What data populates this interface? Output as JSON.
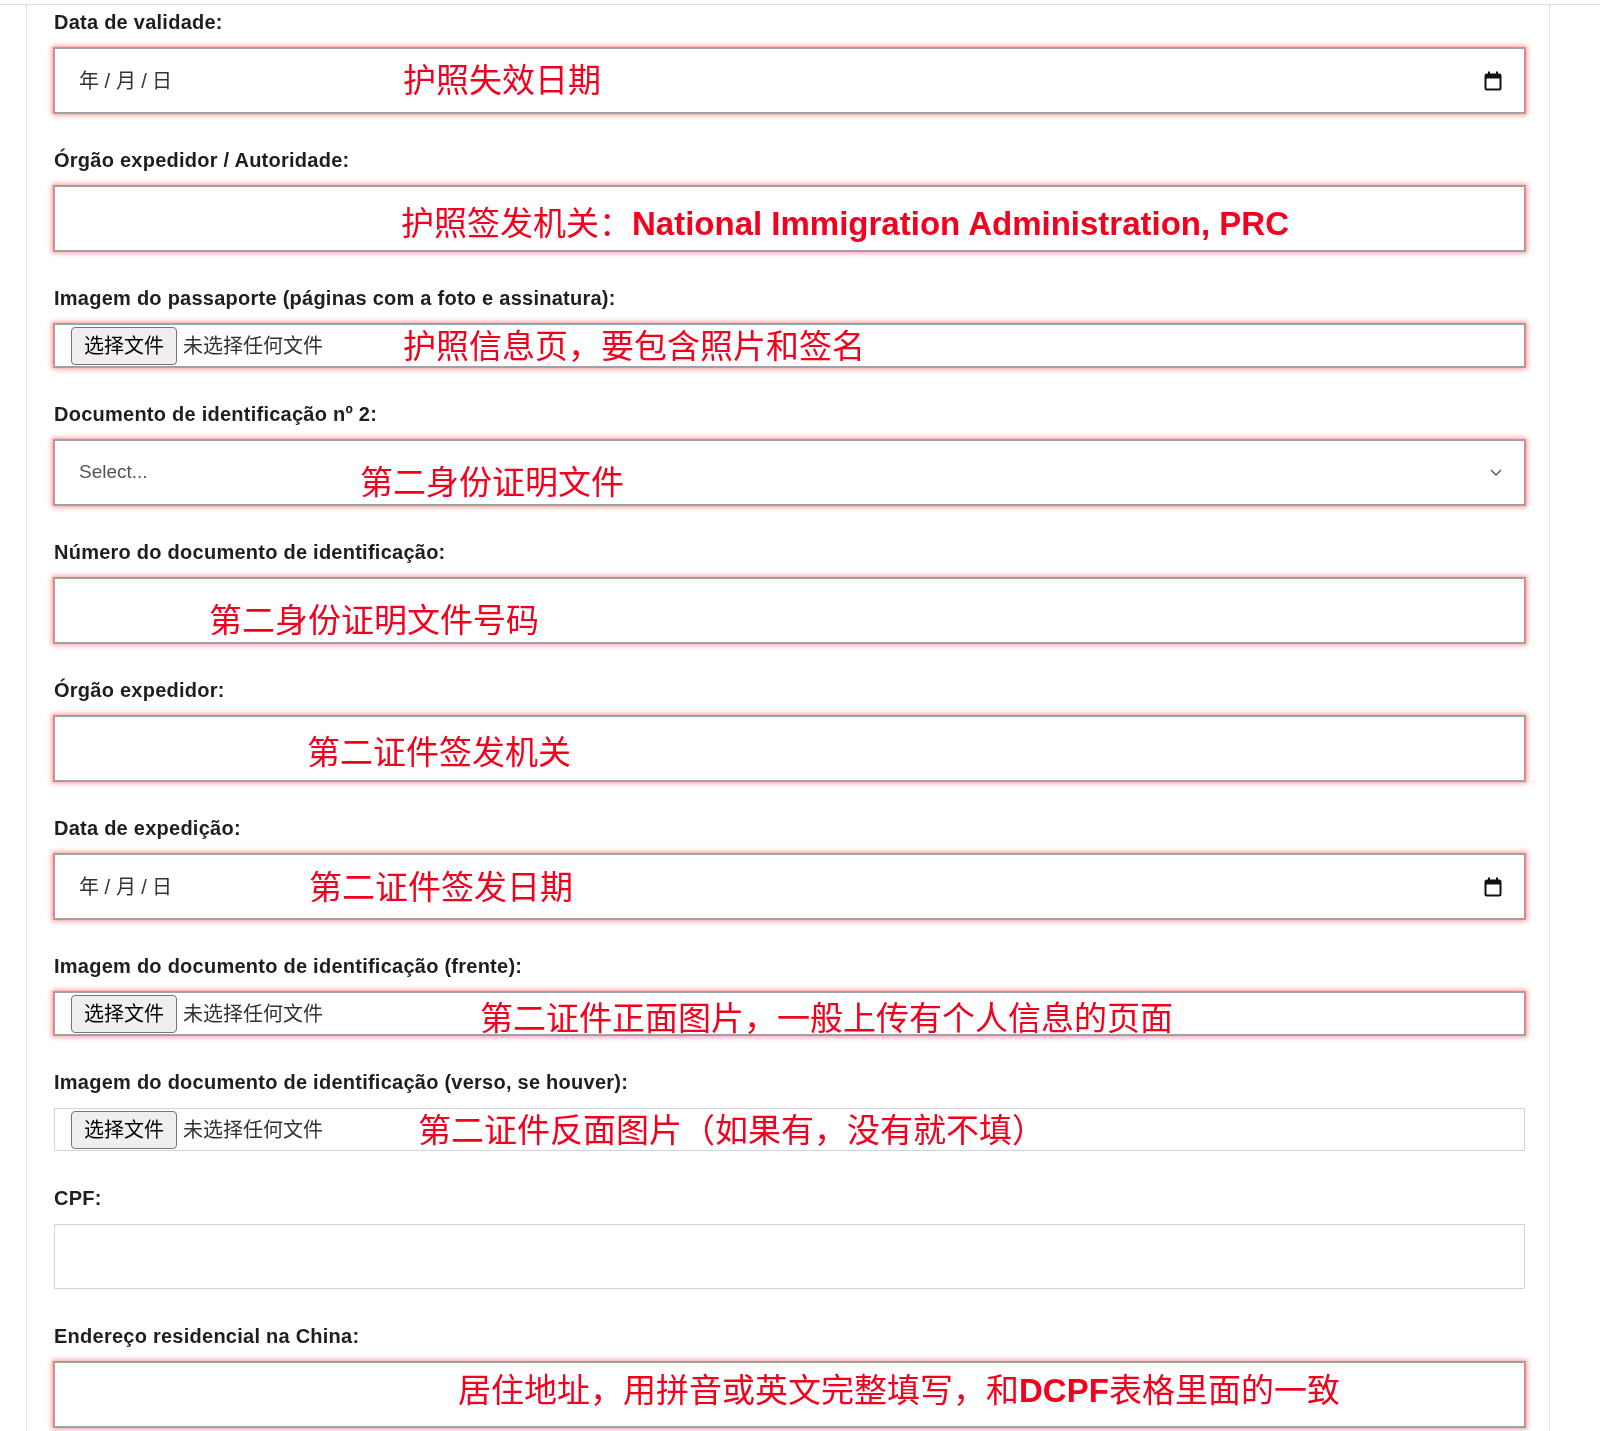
{
  "form": {
    "fields": [
      {
        "kind": "date",
        "label": "Data de validade:",
        "placeholder": "年 / 月 / 日",
        "highlighted": true,
        "annotation": "护照失效日期"
      },
      {
        "kind": "text",
        "label": "Órgão expedidor / Autoridade:",
        "highlighted": true,
        "annotation": "护照签发机关：**National Immigration Administration, PRC**"
      },
      {
        "kind": "file",
        "label": "Imagem do passaporte (páginas com a foto e assinatura):",
        "button": "选择文件",
        "status": "未选择任何文件",
        "highlighted": true,
        "annotation": "护照信息页，要包含照片和签名"
      },
      {
        "kind": "select",
        "label": "Documento de identificação nº 2:",
        "placeholder": "Select...",
        "highlighted": true,
        "annotation": "第二身份证明文件"
      },
      {
        "kind": "text",
        "label": "Número do documento de identificação:",
        "highlighted": true,
        "annotation": "第二身份证明文件号码"
      },
      {
        "kind": "text",
        "label": "Órgão expedidor:",
        "highlighted": true,
        "annotation": "第二证件签发机关"
      },
      {
        "kind": "date",
        "label": "Data de expedição:",
        "placeholder": "年 / 月 / 日",
        "highlighted": true,
        "annotation": "第二证件签发日期"
      },
      {
        "kind": "file",
        "label": "Imagem do documento de identificação (frente):",
        "button": "选择文件",
        "status": "未选择任何文件",
        "highlighted": true,
        "annotation": "第二证件正面图片，一般上传有个人信息的页面"
      },
      {
        "kind": "file",
        "label": "Imagem do documento de identificação (verso, se houver):",
        "button": "选择文件",
        "status": "未选择任何文件",
        "highlighted": false,
        "annotation": "第二证件反面图片（如果有，没有就不填）"
      },
      {
        "kind": "text",
        "label": "CPF:",
        "highlighted": false
      },
      {
        "kind": "text",
        "label": "Endereço residencial na China:",
        "highlighted": true,
        "annotation": "居住地址，用拼音或英文完整填写，和**DCPF**表格里面的一致"
      }
    ]
  }
}
